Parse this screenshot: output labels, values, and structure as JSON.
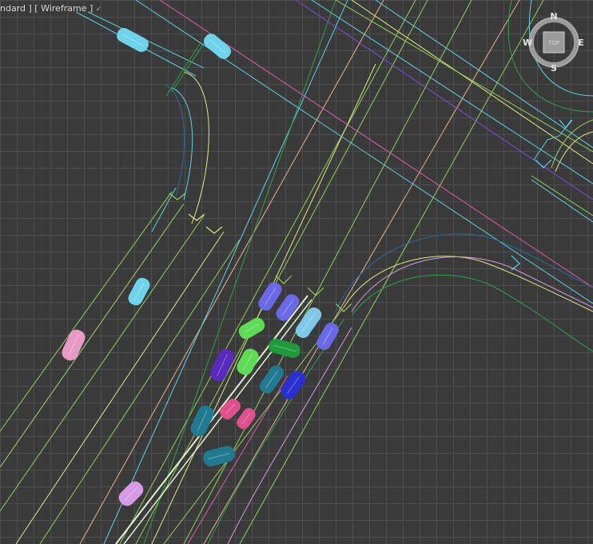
{
  "viewport": {
    "label_standard": "ndard ]",
    "label_render_mode": "[ Wireframe ]",
    "label_menu_marker": "✓"
  },
  "viewcube": {
    "face_label": "TOP",
    "north": "N",
    "south": "S",
    "east": "E",
    "west": "W"
  },
  "colors": {
    "background": "#3a3a3a",
    "grid": "#4e4e4e",
    "road_green": "#8fd15a",
    "road_cyan": "#5ad2e6",
    "road_magenta": "#e05ab0",
    "road_purple": "#7a4be0",
    "road_peach": "#e8b48a",
    "curb_dark_green": "#2fa24a",
    "curb_blue": "#2a6aa0"
  },
  "vehicles": [
    {
      "name": "car-cyan-1",
      "color": "#6fd3ec"
    },
    {
      "name": "car-cyan-2",
      "color": "#6fd3ec"
    },
    {
      "name": "car-cyan-3",
      "color": "#6fd3ec"
    },
    {
      "name": "car-pink-1",
      "color": "#e79ac6"
    },
    {
      "name": "car-green-1",
      "color": "#5fdc55"
    },
    {
      "name": "car-periwinkle-1",
      "color": "#6a6ae8"
    },
    {
      "name": "car-periwinkle-2",
      "color": "#6a6ae8"
    },
    {
      "name": "car-green-2",
      "color": "#5fdc55"
    },
    {
      "name": "car-skyblue-1",
      "color": "#7ec8ea"
    },
    {
      "name": "car-periwinkle-3",
      "color": "#6a6ae8"
    },
    {
      "name": "car-violet-1",
      "color": "#5a2ac0"
    },
    {
      "name": "car-darkgreen-1",
      "color": "#1f9a3a"
    },
    {
      "name": "car-teal-1",
      "color": "#1f7a92"
    },
    {
      "name": "car-teal-2",
      "color": "#1f7a92"
    },
    {
      "name": "car-blue-1",
      "color": "#2a30d0"
    },
    {
      "name": "car-magenta-1",
      "color": "#e0508c"
    },
    {
      "name": "car-magenta-2",
      "color": "#e0508c"
    },
    {
      "name": "car-teal-3",
      "color": "#1f7a92"
    },
    {
      "name": "car-lavender-1",
      "color": "#d69ae6"
    },
    {
      "name": "car-green-3",
      "color": "#5fdc55"
    }
  ]
}
